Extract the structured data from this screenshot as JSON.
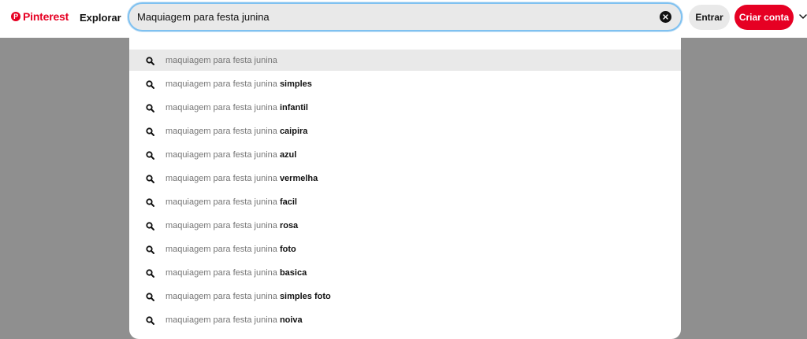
{
  "header": {
    "logo_text": "Pinterest",
    "explore_label": "Explorar",
    "login_label": "Entrar",
    "signup_label": "Criar conta",
    "brand_color": "#e60023"
  },
  "search": {
    "value": "Maquiagem para festa junina"
  },
  "suggestions": [
    {
      "prefix": "maquiagem para festa junina",
      "suffix": ""
    },
    {
      "prefix": "maquiagem para festa junina",
      "suffix": "simples"
    },
    {
      "prefix": "maquiagem para festa junina",
      "suffix": "infantil"
    },
    {
      "prefix": "maquiagem para festa junina",
      "suffix": "caipira"
    },
    {
      "prefix": "maquiagem para festa junina",
      "suffix": "azul"
    },
    {
      "prefix": "maquiagem para festa junina",
      "suffix": "vermelha"
    },
    {
      "prefix": "maquiagem para festa junina",
      "suffix": "facil"
    },
    {
      "prefix": "maquiagem para festa junina",
      "suffix": "rosa"
    },
    {
      "prefix": "maquiagem para festa junina",
      "suffix": "foto"
    },
    {
      "prefix": "maquiagem para festa junina",
      "suffix": "basica"
    },
    {
      "prefix": "maquiagem para festa junina",
      "suffix": "simples foto"
    },
    {
      "prefix": "maquiagem para festa junina",
      "suffix": "noiva"
    }
  ]
}
